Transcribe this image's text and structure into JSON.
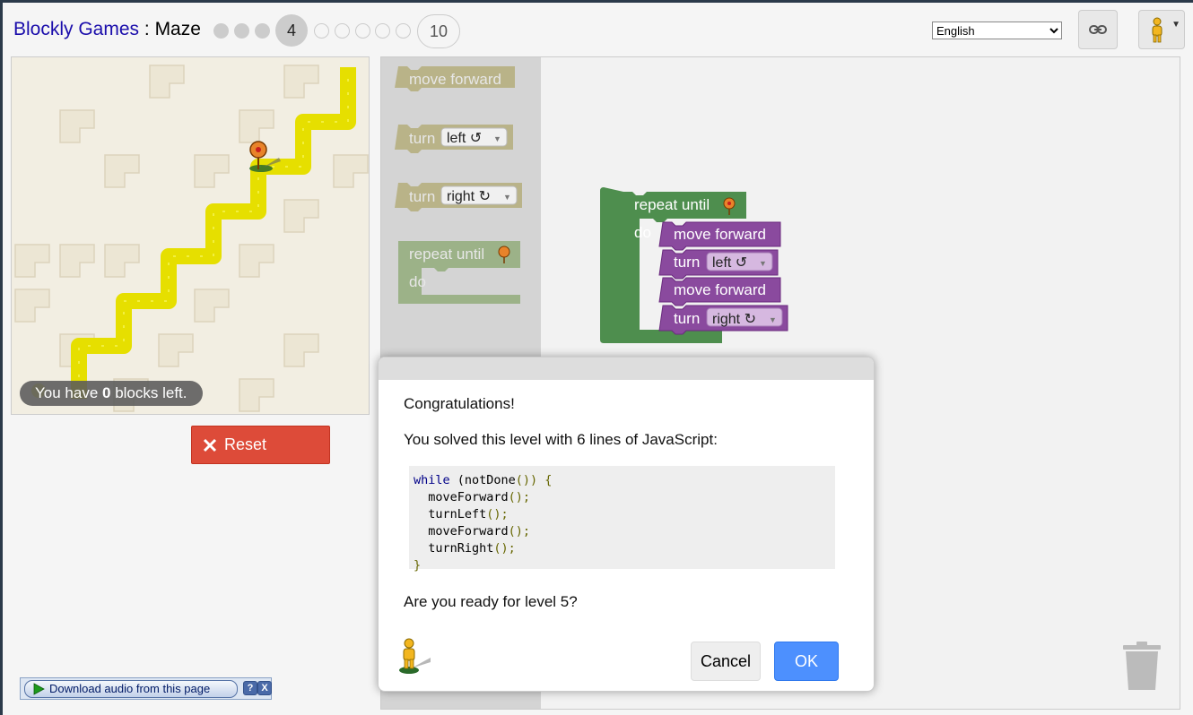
{
  "header": {
    "app_name": "Blockly Games",
    "separator": " : ",
    "game_name": "Maze",
    "levels": {
      "current": "4",
      "last": "10",
      "completed": [
        1,
        2,
        3
      ],
      "remaining": [
        5,
        6,
        7,
        8,
        9
      ]
    },
    "language": "English",
    "icons": {
      "link": "link-icon",
      "avatar": "pegman-icon",
      "menu": "dropdown-caret-icon"
    }
  },
  "maze": {
    "blocks_left_prefix": "You have ",
    "blocks_left_count": "0",
    "blocks_left_suffix": " blocks left.",
    "reset_label": "Reset"
  },
  "toolbox": {
    "move_forward": "move forward",
    "turn": "turn",
    "left": "left ↺",
    "right": "right ↻",
    "repeat_until": "repeat until",
    "do": "do"
  },
  "program": {
    "repeat_until": "repeat until",
    "do": "do",
    "block1": "move forward",
    "block2_turn": "turn",
    "block2_dir": "left ↺",
    "block3": "move forward",
    "block4_turn": "turn",
    "block4_dir": "right ↻"
  },
  "dialog": {
    "congrats": "Congratulations!",
    "summary": "You solved this level with 6 lines of JavaScript:",
    "code": {
      "l1_kw": "while",
      "l1_a": " (notDone",
      "l1_b": "()) {",
      "l2_a": "  moveForward",
      "l2_b": "();",
      "l3_a": "  turnLeft",
      "l3_b": "();",
      "l4_a": "  moveForward",
      "l4_b": "();",
      "l5_a": "  turnRight",
      "l5_b": "();",
      "l6": "}"
    },
    "question": "Are you ready for level 5?",
    "cancel_label": "Cancel",
    "ok_label": "OK"
  },
  "audio_bar": {
    "label": "Download audio from this page",
    "help": "?",
    "close": "X"
  },
  "colors": {
    "link_blue": "#1a0dab",
    "path_yellow": "#e6df00",
    "loop_green": "#5ba55b",
    "motion_purple": "#8a4a9e",
    "reset_red": "#dd4b39",
    "ok_blue": "#4d90fe"
  }
}
